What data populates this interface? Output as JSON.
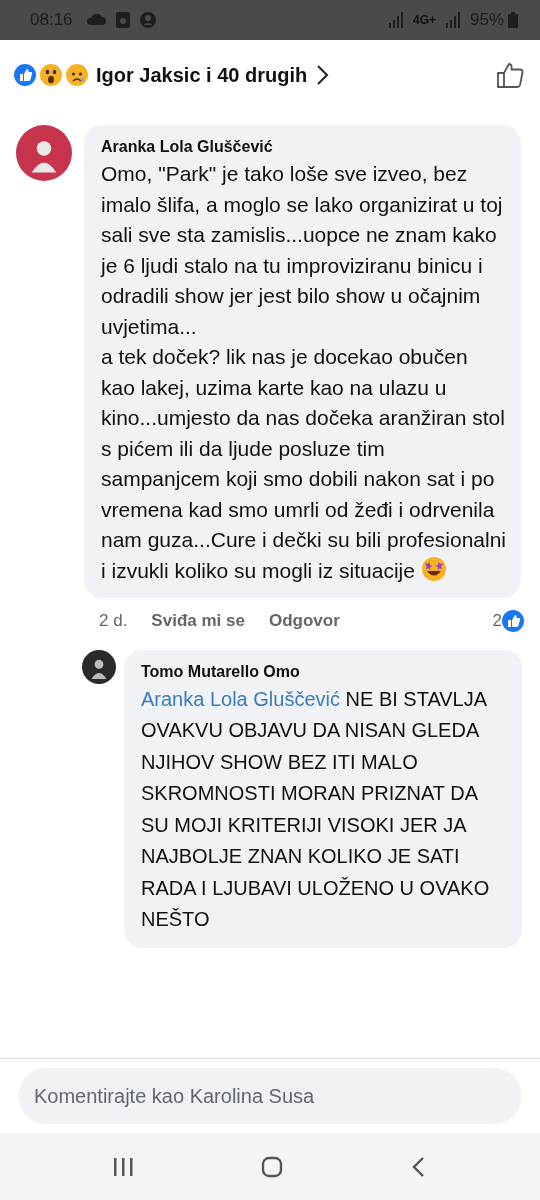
{
  "status_bar": {
    "time": "08:16",
    "network": "4G+",
    "battery": "95%"
  },
  "reactions_bar": {
    "text": "Igor Jaksic i 40 drugih"
  },
  "comments": [
    {
      "author": "Aranka Lola Gluščević",
      "text": "Omo, \"Park\" je tako loše sve izveo, bez imalo šlifa, a moglo se lako organizirat u toj sali sve sta zamislis...uopce ne znam kako je 6 ljudi stalo na tu improviziranu binicu i odradili show jer jest bilo show u očajnim uvjetima...\na tek doček? lik nas je docekao obučen kao lakej, uzima karte kao na ulazu u kino...umjesto da nas dočeka aranžiran stol s pićem ili da ljude posluze tim sampanjcem koji smo dobili nakon sat i po vremena kad smo umrli od žeđi i odrvenila nam guza...Cure i dečki su bili profesionalni i izvukli koliko su mogli iz situacije",
      "emoji": true,
      "time": "2 d.",
      "like_label": "Sviđa mi se",
      "reply_label": "Odgovor",
      "like_count": "2",
      "replies": [
        {
          "author": "Tomo Mutarello Omo",
          "mention": "Aranka Lola Gluščević",
          "text": "NE BI STAVLJA OVAKVU OBJAVU DA NISAN GLEDA NJIHOV SHOW BEZ ITI MALO SKROMNOSTI MORAN PRIZNAT DA SU MOJI KRITERIJI VISOKI JER JA NAJBOLJE ZNAN KOLIKO JE SATI RADA I LJUBAVI ULOŽENO U OVAKO NEŠTO"
        }
      ]
    }
  ],
  "composer": {
    "placeholder": "Komentirajte kao Karolina Susa"
  }
}
